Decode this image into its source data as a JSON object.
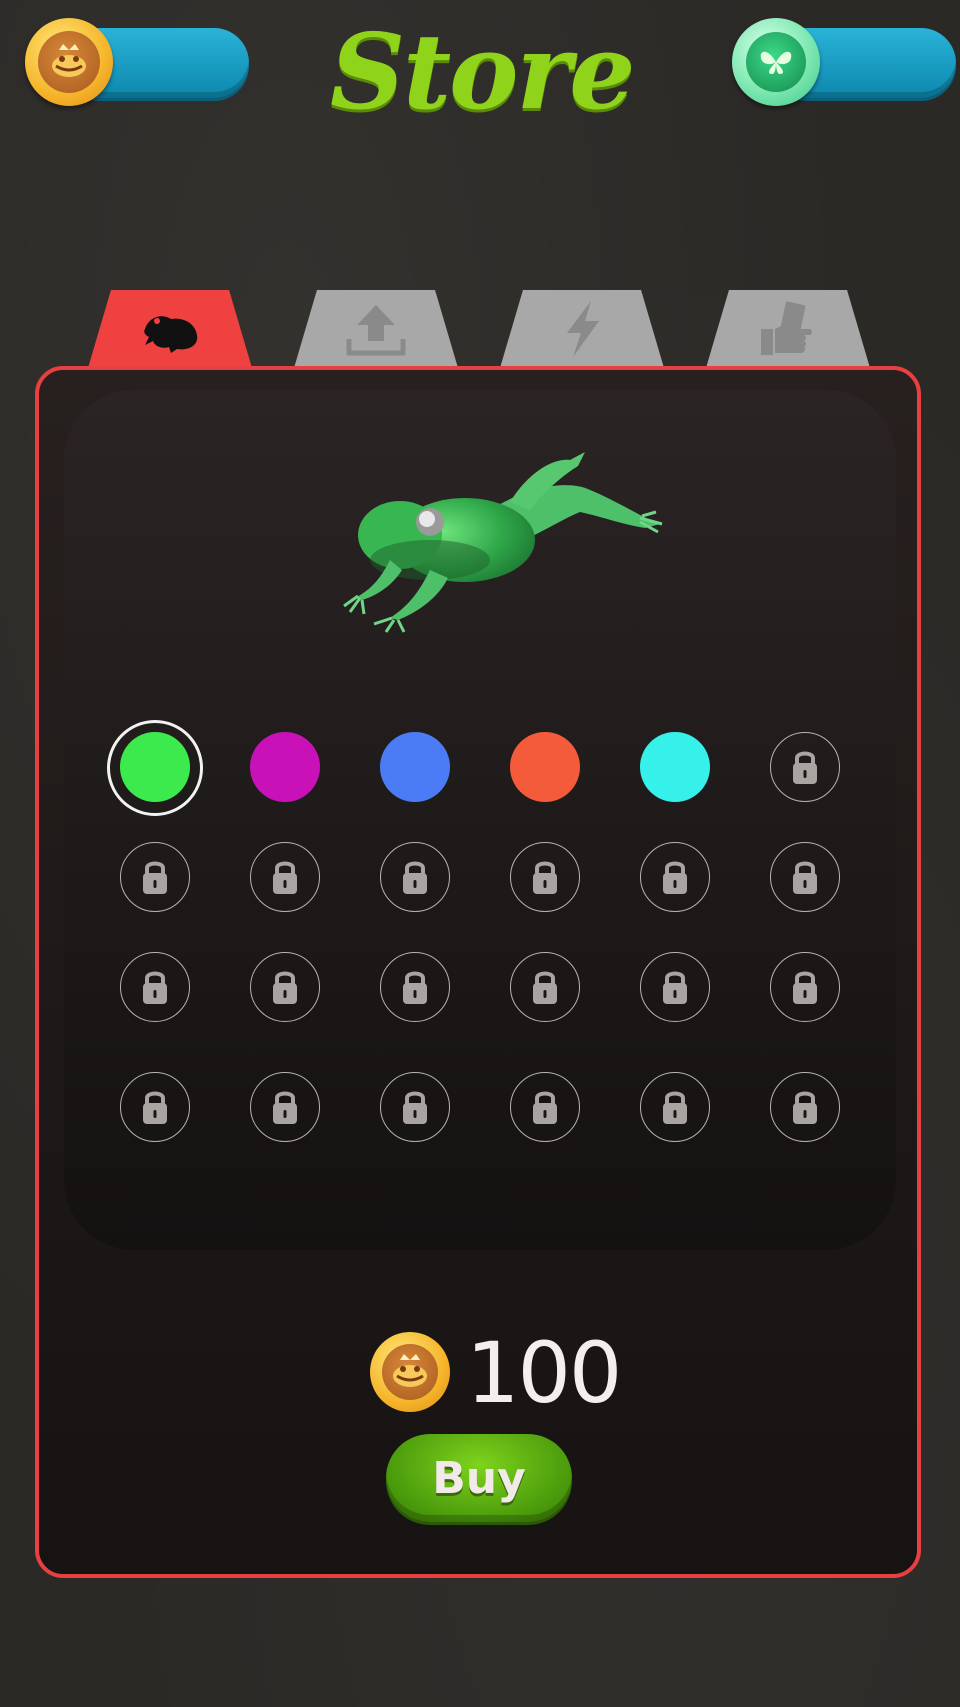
{
  "header": {
    "title": "Store",
    "coins": {
      "icon": "frog-coin-icon",
      "value": ""
    },
    "gems": {
      "icon": "butterfly-gem-icon",
      "value": ""
    }
  },
  "tabs": [
    {
      "id": "skins",
      "icon": "frog-icon",
      "active": true
    },
    {
      "id": "upgrades",
      "icon": "upload-icon",
      "active": false
    },
    {
      "id": "powerups",
      "icon": "lightning-icon",
      "active": false
    },
    {
      "id": "cash",
      "icon": "hand-money-icon",
      "active": false
    }
  ],
  "preview": {
    "icon": "frog-preview"
  },
  "swatches": [
    {
      "color": "#3dea4e",
      "locked": false,
      "selected": true
    },
    {
      "color": "#c812b8",
      "locked": false,
      "selected": false
    },
    {
      "color": "#4b7cf6",
      "locked": false,
      "selected": false
    },
    {
      "color": "#f45b3a",
      "locked": false,
      "selected": false
    },
    {
      "color": "#35f1ea",
      "locked": false,
      "selected": false
    },
    {
      "locked": true
    },
    {
      "locked": true
    },
    {
      "locked": true
    },
    {
      "locked": true
    },
    {
      "locked": true
    },
    {
      "locked": true
    },
    {
      "locked": true
    },
    {
      "locked": true
    },
    {
      "locked": true
    },
    {
      "locked": true
    },
    {
      "locked": true
    },
    {
      "locked": true
    },
    {
      "locked": true
    },
    {
      "locked": true
    },
    {
      "locked": true
    },
    {
      "locked": true
    },
    {
      "locked": true
    },
    {
      "locked": true
    },
    {
      "locked": true
    }
  ],
  "price": {
    "icon": "frog-coin-icon",
    "amount": "100"
  },
  "buy_label": "Buy"
}
